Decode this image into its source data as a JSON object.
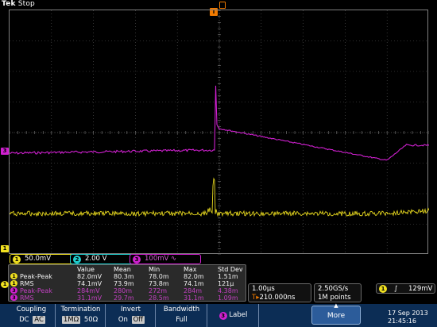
{
  "status": {
    "brand": "Tek",
    "state": "Stop"
  },
  "colors": {
    "ch1": "#f0e020",
    "ch2": "#20d0d0",
    "ch3": "#d020d0",
    "softkey_bg": "#0c2d55",
    "grid": "#5a5a5a"
  },
  "markers": {
    "trigger_top": "T",
    "ch3_left": "3",
    "ch1_left": "1"
  },
  "channel_scales": [
    {
      "num": "1",
      "scale": "50.0mV"
    },
    {
      "num": "2",
      "scale": "2.00 V"
    },
    {
      "num": "3",
      "scale": "100mV ∿"
    }
  ],
  "measurements": {
    "headers": [
      "Value",
      "Mean",
      "Min",
      "Max",
      "Std Dev"
    ],
    "rows": [
      {
        "ch": "1",
        "name": "Peak-Peak",
        "value": "82.0mV",
        "mean": "80.3m",
        "min": "78.0m",
        "max": "82.0m",
        "std": "1.51m"
      },
      {
        "ch": "1",
        "name": "RMS",
        "value": "74.1mV",
        "mean": "73.9m",
        "min": "73.8m",
        "max": "74.1m",
        "std": "121µ"
      },
      {
        "ch": "3",
        "name": "Peak-Peak",
        "value": "284mV",
        "mean": "280m",
        "min": "272m",
        "max": "284m",
        "std": "4.38m"
      },
      {
        "ch": "3",
        "name": "RMS",
        "value": "31.1mV",
        "mean": "29.7m",
        "min": "28.5m",
        "max": "31.1m",
        "std": "1.09m"
      }
    ]
  },
  "timebase": {
    "scale": "1.00µs",
    "delay": "210.000ns",
    "delay_prefix": "T▸"
  },
  "acquisition": {
    "rate": "2.50GS/s",
    "points": "1M points"
  },
  "trigger": {
    "ch": "1",
    "slope": "∫",
    "level": "129mV"
  },
  "softkeys": {
    "coupling": {
      "title": "Coupling",
      "opt1": "DC",
      "opt2": "AC"
    },
    "termination": {
      "title": "Termination",
      "opt1": "1MΩ",
      "opt2": "50Ω"
    },
    "invert": {
      "title": "Invert",
      "opt1": "On",
      "opt2": "Off"
    },
    "bandwidth": {
      "title": "Bandwidth",
      "value": "Full"
    },
    "label": {
      "ch": "3",
      "title": "Label"
    },
    "more": {
      "title": "More",
      "arrow": "▲"
    }
  },
  "datetime": {
    "date": "17 Sep 2013",
    "time": "21:45:16"
  }
}
